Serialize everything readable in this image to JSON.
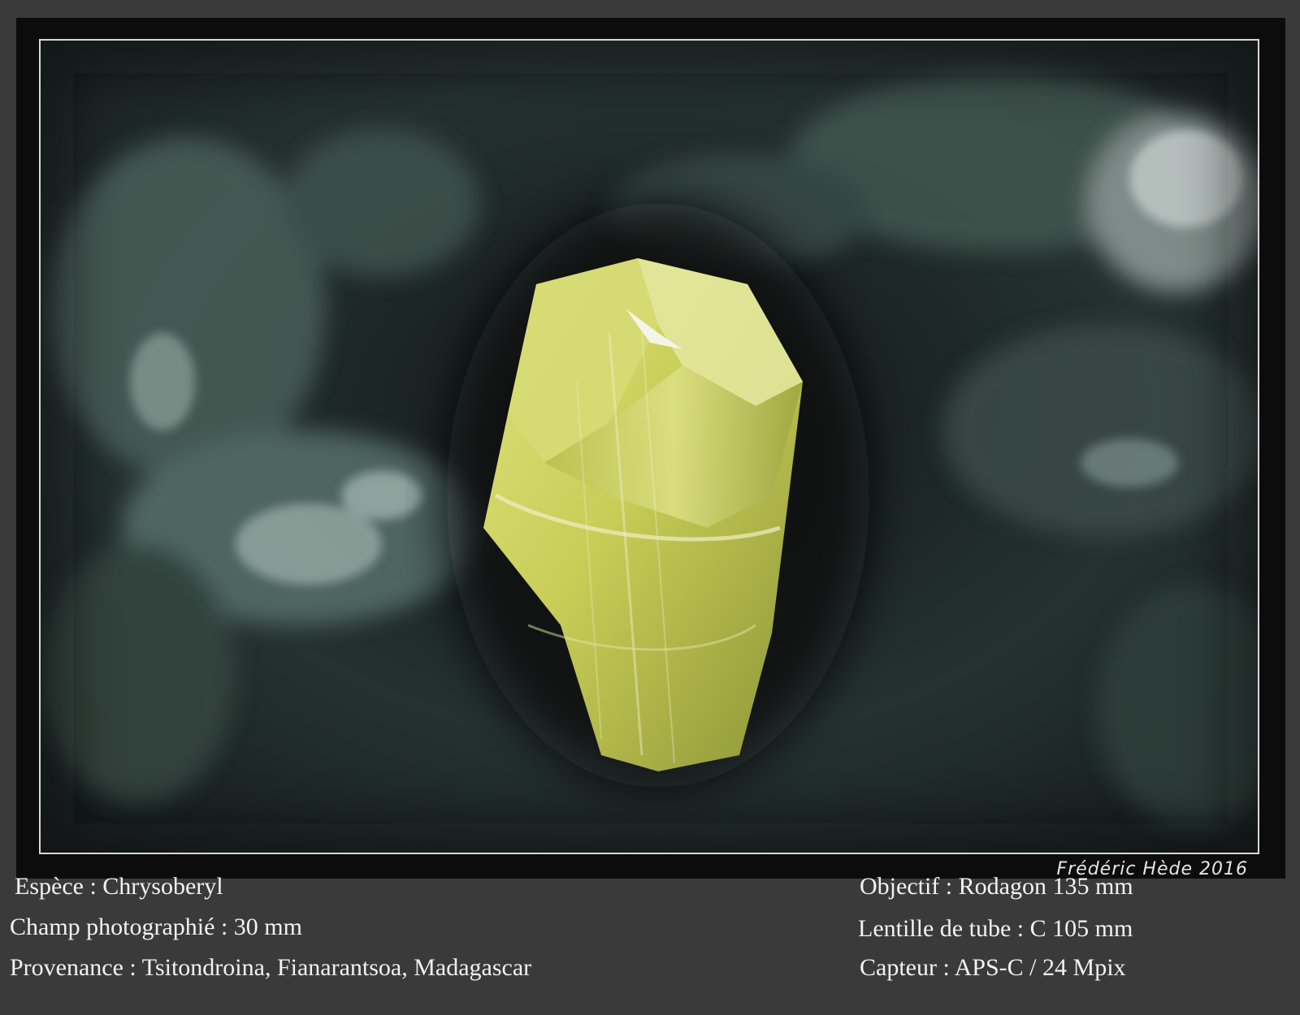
{
  "signature": "Frédéric Hède 2016",
  "caption_left": {
    "species": "Espèce : Chrysoberyl",
    "field": "Champ photographié : 30 mm",
    "provenance": "Provenance : Tsitondroina, Fianarantsoa, Madagascar"
  },
  "caption_right": {
    "objective": "Objectif : Rodagon 135 mm",
    "tube_lens": "Lentille de tube : C 105 mm",
    "sensor": "Capteur : APS-C / 24 Mpix"
  },
  "colors": {
    "background": "#3a3a3a",
    "mount": "#0c0c0c",
    "crystal": "#c9cf5a",
    "matrix": "#243030"
  }
}
